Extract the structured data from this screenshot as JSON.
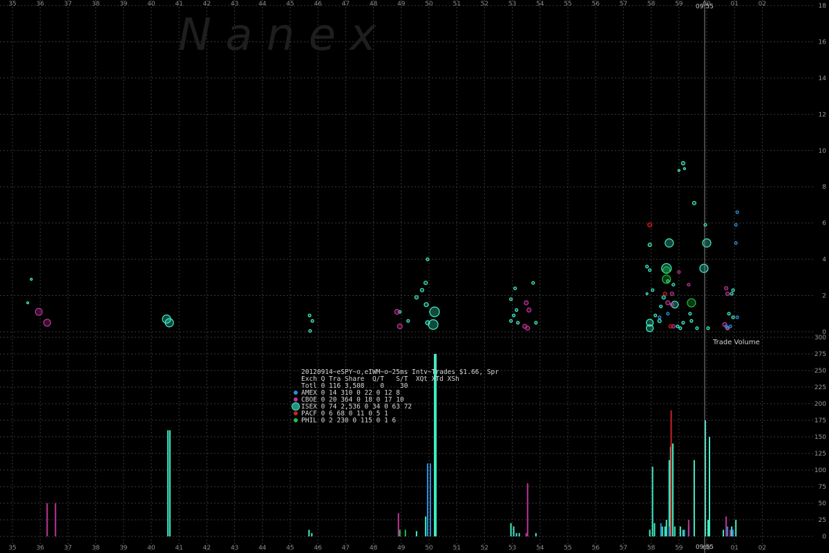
{
  "watermark": "N a n e x",
  "cursor_time": "09:55",
  "bottom_panel_label": "Trade Volume",
  "chart_data": [
    {
      "type": "scatter",
      "panel": "top",
      "ylim": [
        0,
        18
      ],
      "yticks": [
        0,
        2,
        4,
        6,
        8,
        10,
        12,
        14,
        16,
        18
      ],
      "xlim": [
        35,
        62.8
      ],
      "xticks": [
        "35",
        "36",
        "37",
        "38",
        "39",
        "40",
        "41",
        "42",
        "43",
        "44",
        "45",
        "46",
        "47",
        "48",
        "49",
        "50",
        "51",
        "52",
        "53",
        "54",
        "55",
        "56",
        "57",
        "58",
        "59",
        "00",
        "01",
        "02"
      ],
      "grid": true,
      "colors": {
        "AMEX": "#2a8fd8",
        "CBOE": "#c0359a",
        "ISEX": "#40f0c8",
        "PACF": "#d02020",
        "PHIL": "#20c040"
      },
      "series": [
        {
          "name": "ISEX",
          "points": [
            [
              35.55,
              1.6,
              1.5
            ],
            [
              35.68,
              2.9,
              1.5
            ],
            [
              40.55,
              0.7,
              6
            ],
            [
              40.65,
              0.5,
              6
            ],
            [
              45.7,
              0.9,
              2
            ],
            [
              45.8,
              0.6,
              2
            ],
            [
              45.72,
              0.05,
              2
            ],
            [
              48.95,
              1.1,
              2
            ],
            [
              49.25,
              0.6,
              2
            ],
            [
              49.55,
              1.9,
              2.5
            ],
            [
              49.75,
              2.3,
              2.5
            ],
            [
              49.88,
              2.7,
              2.5
            ],
            [
              49.95,
              4.0,
              2
            ],
            [
              49.9,
              1.5,
              3
            ],
            [
              49.95,
              0.5,
              3
            ],
            [
              50.2,
              1.1,
              7
            ],
            [
              50.15,
              0.4,
              7
            ],
            [
              52.95,
              1.8,
              2
            ],
            [
              53.1,
              2.4,
              2
            ],
            [
              53.05,
              0.9,
              2
            ],
            [
              52.95,
              0.6,
              2
            ],
            [
              53.15,
              1.2,
              2
            ],
            [
              53.2,
              0.5,
              2
            ],
            [
              53.75,
              2.7,
              2
            ],
            [
              53.85,
              0.5,
              2
            ],
            [
              57.85,
              3.6,
              2
            ],
            [
              57.95,
              4.8,
              2.5
            ],
            [
              57.95,
              3.4,
              2
            ],
            [
              57.85,
              2.1,
              1.5
            ],
            [
              57.95,
              0.2,
              5
            ],
            [
              57.95,
              0.5,
              5
            ],
            [
              58.05,
              2.3,
              2
            ],
            [
              58.15,
              0.9,
              2
            ],
            [
              58.3,
              0.6,
              2.5
            ],
            [
              58.35,
              1.4,
              2
            ],
            [
              58.45,
              1.9,
              2.5
            ],
            [
              58.55,
              3.5,
              7
            ],
            [
              58.6,
              2.8,
              2
            ],
            [
              58.65,
              4.9,
              6
            ],
            [
              58.8,
              2.6,
              2
            ],
            [
              58.85,
              1.5,
              5
            ],
            [
              58.95,
              0.3,
              2
            ],
            [
              59.05,
              0.2,
              2
            ],
            [
              59.15,
              0.5,
              2
            ],
            [
              59.0,
              8.9,
              1.5
            ],
            [
              59.15,
              9.3,
              2.5
            ],
            [
              59.2,
              9.0,
              1.5
            ],
            [
              59.4,
              1.0,
              2
            ],
            [
              59.45,
              0.6,
              2
            ],
            [
              59.55,
              7.1,
              2.5
            ],
            [
              59.65,
              0.2,
              2
            ],
            [
              59.9,
              3.5,
              6
            ],
            [
              59.95,
              5.9,
              2
            ],
            [
              60.0,
              4.9,
              6
            ],
            [
              60.05,
              0.2,
              2
            ],
            [
              60.75,
              0.2,
              2
            ],
            [
              60.8,
              1.0,
              2
            ],
            [
              60.9,
              2.1,
              2
            ],
            [
              60.95,
              2.3,
              2
            ],
            [
              60.95,
              0.8,
              2
            ]
          ]
        },
        {
          "name": "CBOE",
          "points": [
            [
              35.95,
              1.1,
              5
            ],
            [
              36.25,
              0.5,
              5
            ],
            [
              48.85,
              1.1,
              3.5
            ],
            [
              48.95,
              0.3,
              3.5
            ],
            [
              53.5,
              1.6,
              3
            ],
            [
              53.55,
              0.2,
              3
            ],
            [
              53.6,
              1.2,
              3
            ],
            [
              53.45,
              0.3,
              3
            ],
            [
              58.6,
              1.6,
              3
            ],
            [
              58.75,
              2.1,
              2.5
            ],
            [
              58.75,
              1.5,
              2.5
            ],
            [
              58.8,
              0.3,
              2.5
            ],
            [
              59.0,
              3.3,
              2
            ],
            [
              59.35,
              2.6,
              2
            ],
            [
              60.65,
              0.4,
              3
            ],
            [
              60.7,
              2.4,
              2.5
            ],
            [
              60.75,
              2.1,
              2.5
            ],
            [
              60.75,
              0.2,
              2.5
            ]
          ]
        },
        {
          "name": "AMEX",
          "points": [
            [
              58.3,
              0.8,
              2
            ],
            [
              58.6,
              1.0,
              2
            ],
            [
              61.1,
              6.6,
              2
            ],
            [
              61.05,
              5.9,
              2
            ],
            [
              61.05,
              4.9,
              2
            ],
            [
              61.1,
              0.8,
              2
            ],
            [
              60.85,
              0.3,
              2
            ],
            [
              60.7,
              0.3,
              2
            ]
          ]
        },
        {
          "name": "PACF",
          "points": [
            [
              57.95,
              5.9,
              3
            ],
            [
              58.5,
              2.1,
              2.5
            ],
            [
              58.7,
              0.3,
              2.5
            ]
          ]
        },
        {
          "name": "PHIL",
          "points": [
            [
              58.55,
              2.9,
              6
            ],
            [
              58.55,
              3.4,
              5
            ],
            [
              59.45,
              1.6,
              6
            ]
          ]
        }
      ]
    },
    {
      "type": "bar",
      "panel": "bottom",
      "label": "Trade Volume",
      "ylim": [
        0,
        300
      ],
      "yticks": [
        0,
        25,
        50,
        75,
        100,
        125,
        150,
        175,
        200,
        225,
        250,
        275,
        300
      ],
      "xlim": [
        35,
        62.8
      ],
      "xticks": [
        "35",
        "36",
        "37",
        "38",
        "39",
        "40",
        "41",
        "42",
        "43",
        "44",
        "45",
        "46",
        "47",
        "48",
        "49",
        "50",
        "51",
        "52",
        "53",
        "54",
        "55",
        "56",
        "57",
        "58",
        "59",
        "00",
        "01",
        "02"
      ],
      "grid": true,
      "series": [
        {
          "name": "ISEX",
          "bars": [
            [
              40.6,
              160
            ],
            [
              40.67,
              160
            ],
            [
              45.68,
              10
            ],
            [
              45.78,
              5
            ],
            [
              49.55,
              8
            ],
            [
              49.88,
              30
            ],
            [
              50.2,
              275
            ],
            [
              50.25,
              275
            ],
            [
              52.95,
              20
            ],
            [
              53.05,
              15
            ],
            [
              53.15,
              5
            ],
            [
              53.25,
              5
            ],
            [
              53.85,
              5
            ],
            [
              57.95,
              10
            ],
            [
              58.05,
              105
            ],
            [
              58.12,
              20
            ],
            [
              58.4,
              15
            ],
            [
              58.5,
              15
            ],
            [
              58.55,
              25
            ],
            [
              58.65,
              115
            ],
            [
              58.7,
              135
            ],
            [
              58.78,
              140
            ],
            [
              58.85,
              15
            ],
            [
              59.05,
              15
            ],
            [
              59.15,
              10
            ],
            [
              59.35,
              15
            ],
            [
              59.55,
              115
            ],
            [
              59.95,
              175
            ],
            [
              60.05,
              25
            ],
            [
              60.1,
              150
            ],
            [
              60.6,
              10
            ],
            [
              60.9,
              15
            ],
            [
              61.05,
              25
            ]
          ]
        },
        {
          "name": "CBOE",
          "bars": [
            [
              36.25,
              50
            ],
            [
              36.55,
              50
            ],
            [
              48.9,
              35
            ],
            [
              53.55,
              80
            ],
            [
              53.5,
              5
            ],
            [
              59.35,
              25
            ],
            [
              60.7,
              30
            ],
            [
              60.85,
              10
            ]
          ]
        },
        {
          "name": "AMEX",
          "bars": [
            [
              49.95,
              110
            ],
            [
              50.05,
              110
            ],
            [
              58.35,
              20
            ],
            [
              58.65,
              15
            ],
            [
              59.2,
              10
            ],
            [
              60.75,
              15
            ],
            [
              60.95,
              10
            ]
          ]
        },
        {
          "name": "PACF",
          "bars": [
            [
              58.72,
              190
            ]
          ]
        },
        {
          "name": "PHIL",
          "bars": [
            [
              48.95,
              10
            ],
            [
              49.15,
              10
            ]
          ]
        }
      ]
    }
  ],
  "legend": {
    "title": "20120914~eSPY~o,eIWM~o~25ms Intv~Trades $1.66, Spr",
    "header": "Exch Q Tra Share  Q/T   S/T  XQt XTd XSh",
    "total": "Totl 0 116 3,508    0    30",
    "rows": [
      {
        "exchange": "AMEX",
        "color": "#2a8fd8",
        "text": "AMEX 0  14   310    0    22   0  12   8"
      },
      {
        "exchange": "CBOE",
        "color": "#c0359a",
        "text": "CBOE 0  20   364    0    18   0  17  10"
      },
      {
        "exchange": "ISEX",
        "color": "#40f0c8",
        "text": "ISEX 0  74 2,536    0    34   0  63  72"
      },
      {
        "exchange": "PACF",
        "color": "#d02020",
        "text": "PACF 0   6    68    0    11   0   5   1"
      },
      {
        "exchange": "PHIL",
        "color": "#20c040",
        "text": "PHIL 0   2   230    0   115   0   1   6"
      }
    ]
  }
}
